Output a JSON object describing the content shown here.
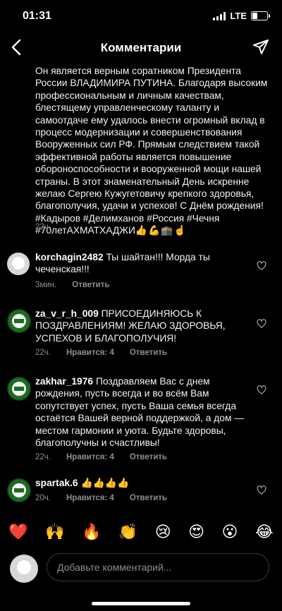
{
  "status": {
    "time": "01:31",
    "network": "LTE"
  },
  "header": {
    "title": "Комментарии"
  },
  "caption": {
    "text": "Он является верным соратником Президента России ВЛАДИМИРА ПУТИНА. Благодаря высоким профессиональным и личным качествам, блестящему управленческому таланту и самоотдаче ему удалось внести огромный вклад в процесс модернизации и совершенствования Вооруженных сил РФ. Прямым следствием такой эффективной работы является повышение обороноспособности и вооруженной мощи нашей страны. В этот знаменательный День искренне желаю Сергею Кужугетовичу крепкого здоровья, благополучия, удачи и успехов! С Днём рождения! #Кадыров #Делимханов #Россия #Чечня #70летАХМАТХАДЖИ",
    "emoji": "👍💪🕋☝️",
    "time": "22ч."
  },
  "comments": [
    {
      "user": "korchagin2482",
      "text": "Ты шайтан!!! Морда ты чеченская!!!",
      "time": "3мин.",
      "likes": "",
      "reply": "Ответить"
    },
    {
      "user": "za_v_r_h_009",
      "text": "ПРИСОЕДИНЯЮСЬ К ПОЗДРАВЛЕНИЯМ! ЖЕЛАЮ ЗДОРОВЬЯ, УСПЕХОВ И БЛАГОПОЛУЧИЯ!",
      "time": "22ч.",
      "likes": "Нравится: 4",
      "reply": "Ответить"
    },
    {
      "user": "zakhar_1976",
      "text": "Поздравляем Вас с днем рождения, пусть всегда и во всём Вам сопутствует успех, пусть Ваша семья всегда остаётся Вашей верной поддержкой, а дом — местом гармонии и уюта. Будьте здоровы, благополучны и счастливы!",
      "time": "22ч.",
      "likes": "Нравится: 4",
      "reply": "Ответить"
    },
    {
      "user": "spartak.6",
      "text": "👍👍👍👍",
      "time": "20ч.",
      "likes": "Нравится: 4",
      "reply": "Ответить"
    }
  ],
  "reactions": [
    "❤️",
    "🙌",
    "🔥",
    "👏",
    "😢",
    "😍",
    "😮",
    "😂"
  ],
  "input": {
    "placeholder": "Добавьте комментарий..."
  },
  "colors": {
    "background": "#000000",
    "meta": "#8e8e8e",
    "text": "#f2f2f2"
  }
}
